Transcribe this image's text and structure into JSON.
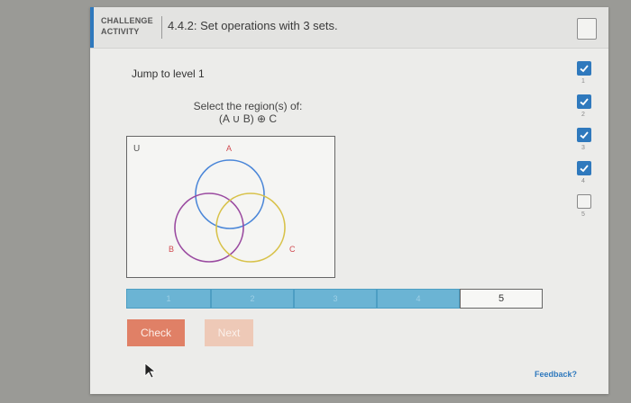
{
  "header": {
    "badge": "CHALLENGE ACTIVITY",
    "title": "4.4.2: Set operations with 3 sets."
  },
  "jump_label": "Jump to level 1",
  "prompt": {
    "line1": "Select the region(s) of:",
    "line2": "(A ∪ B) ⊕ C"
  },
  "venn": {
    "universe_label": "U",
    "set_a_label": "A",
    "set_b_label": "B",
    "set_c_label": "C",
    "colors": {
      "a": "#4a86d8",
      "b": "#9a4aa0",
      "c": "#d8c24a"
    }
  },
  "progress": {
    "segments": [
      "1",
      "2",
      "3",
      "4",
      "5"
    ],
    "completed": 4,
    "current": "5"
  },
  "buttons": {
    "check": "Check",
    "next": "Next"
  },
  "feedback_link": "Feedback?",
  "level_sidebar": [
    {
      "num": "1",
      "done": true
    },
    {
      "num": "2",
      "done": true
    },
    {
      "num": "3",
      "done": true
    },
    {
      "num": "4",
      "done": true
    },
    {
      "num": "5",
      "done": false
    }
  ]
}
